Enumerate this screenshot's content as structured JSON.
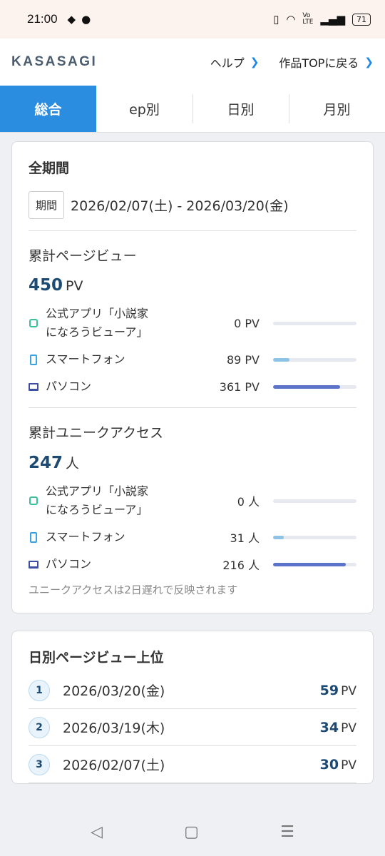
{
  "status_bar": {
    "time": "21:00",
    "battery": "71"
  },
  "header": {
    "logo": "KASASAGI",
    "help": "ヘルプ",
    "back": "作品TOPに戻る"
  },
  "tabs": [
    "総合",
    "ep別",
    "日別",
    "月別"
  ],
  "summary": {
    "title": "全期間",
    "period_label": "期間",
    "period_value": "2026/02/07(土) - 2026/03/20(金)",
    "pageviews": {
      "title": "累計ページビュー",
      "total": "450",
      "unit": "PV",
      "rows": [
        {
          "label_line1": "公式アプリ「小説家",
          "label_line2": "になろうビューア」",
          "value": "0 PV",
          "fraction": 0,
          "color": "#36c19a"
        },
        {
          "label": "スマートフォン",
          "value": "89 PV",
          "fraction": 0.197,
          "color": "#8ec3e8"
        },
        {
          "label": "パソコン",
          "value": "361 PV",
          "fraction": 0.802,
          "color": "#5b73c9"
        }
      ]
    },
    "unique": {
      "title": "累計ユニークアクセス",
      "total": "247",
      "unit": "人",
      "rows": [
        {
          "label_line1": "公式アプリ「小説家",
          "label_line2": "になろうビューア」",
          "value": "0 人",
          "fraction": 0,
          "color": "#36c19a"
        },
        {
          "label": "スマートフォン",
          "value": "31 人",
          "fraction": 0.126,
          "color": "#8ec3e8"
        },
        {
          "label": "パソコン",
          "value": "216 人",
          "fraction": 0.874,
          "color": "#5b73c9"
        }
      ],
      "note": "ユニークアクセスは2日遅れで反映されます"
    }
  },
  "daily_top": {
    "title": "日別ページビュー上位",
    "unit": "PV",
    "rows": [
      {
        "rank": "1",
        "date": "2026/03/20(金)",
        "value": "59"
      },
      {
        "rank": "2",
        "date": "2026/03/19(木)",
        "value": "34"
      },
      {
        "rank": "3",
        "date": "2026/02/07(土)",
        "value": "30"
      }
    ]
  }
}
